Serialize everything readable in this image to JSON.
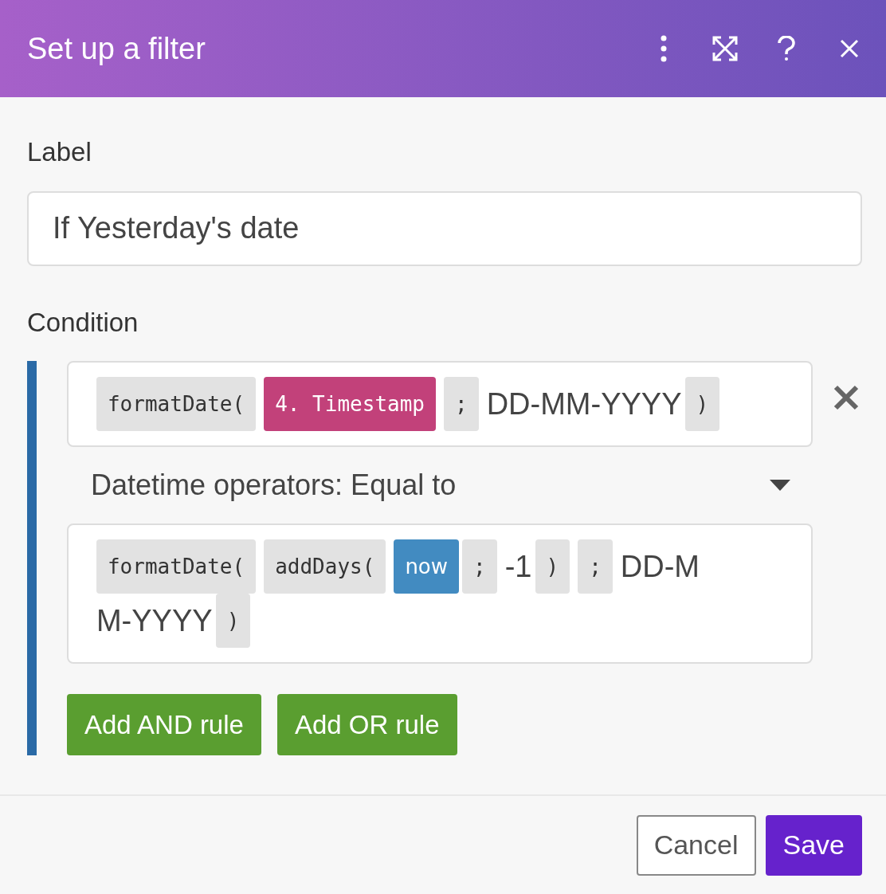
{
  "dialog": {
    "title": "Set up a filter"
  },
  "label_field": {
    "label": "Label",
    "value": "If Yesterday's date"
  },
  "condition": {
    "label": "Condition",
    "first_operand": [
      {
        "kind": "function",
        "text": "formatDate("
      },
      {
        "kind": "variable",
        "text": "4. Timestamp"
      },
      {
        "kind": "function",
        "text": ";"
      },
      {
        "kind": "text",
        "text": "DD-MM-YYYY"
      },
      {
        "kind": "function",
        "text": ")"
      }
    ],
    "operator": "Datetime operators: Equal to",
    "second_operand": [
      {
        "kind": "function",
        "text": "formatDate("
      },
      {
        "kind": "function",
        "text": "addDays("
      },
      {
        "kind": "keyword",
        "text": "now"
      },
      {
        "kind": "function",
        "text": ";"
      },
      {
        "kind": "text",
        "text": "-1"
      },
      {
        "kind": "function",
        "text": ")"
      },
      {
        "kind": "function",
        "text": ";"
      },
      {
        "kind": "text",
        "text": "DD-M"
      },
      {
        "kind": "text",
        "text": "M-YYYY"
      },
      {
        "kind": "function",
        "text": ")"
      }
    ],
    "buttons": [
      "Add AND rule",
      "Add OR rule"
    ]
  },
  "footer": {
    "buttons": [
      {
        "kind": "secondary",
        "label": "Cancel"
      },
      {
        "kind": "primary",
        "label": "Save"
      }
    ]
  }
}
